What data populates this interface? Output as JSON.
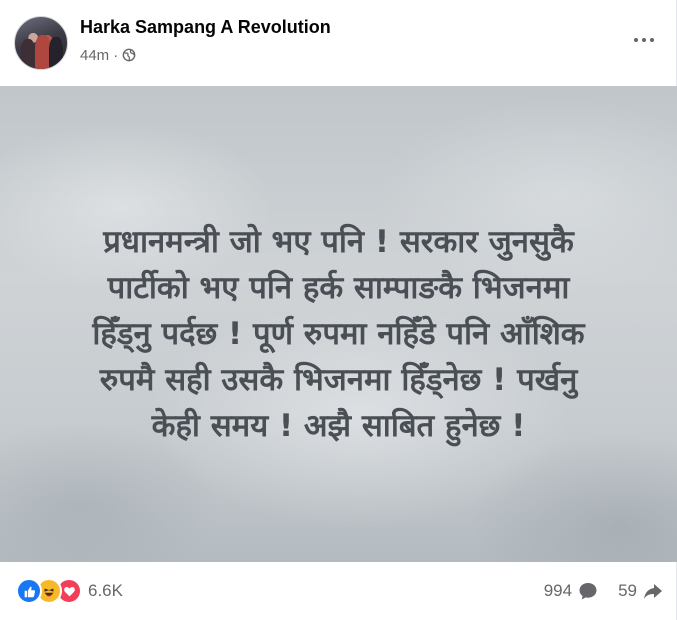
{
  "post": {
    "author": "Harka Sampang A Revolution",
    "time": "44m",
    "separator": "·",
    "privacy_icon": "globe-icon",
    "more_icon": "more-options-icon",
    "image_text_lines": [
      "प्रधानमन्त्री जो भए पनि ! सरकार जुनसुकै",
      "पार्टीको भए पनि हर्क साम्पाङकै भिजनमा",
      "हिँड्नु पर्दछ ! पूर्ण रुपमा नहिँडे पनि आँशिक",
      "रुपमै सही उसकै भिजनमा हिँड्नेछ ! पर्खनु",
      "केही समय ! अझै साबित हुनेछ !"
    ]
  },
  "footer": {
    "reaction_icons": [
      "like-icon",
      "haha-icon",
      "love-icon"
    ],
    "reaction_count": "6.6K",
    "comment_count": "994",
    "share_count": "59"
  },
  "colors": {
    "like": "#1877f2",
    "haha": "#f7b928",
    "love": "#f33e58",
    "secondary_text": "#65676b"
  }
}
